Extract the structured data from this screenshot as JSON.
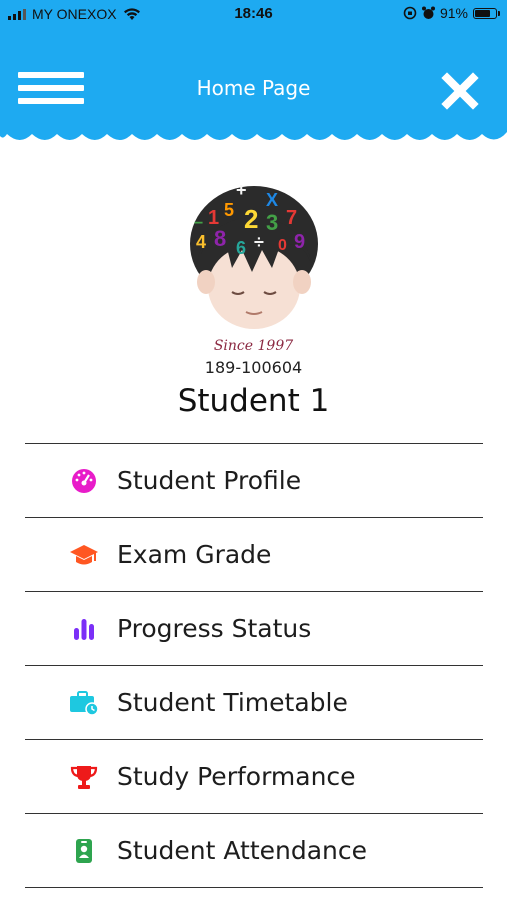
{
  "status": {
    "carrier": "MY ONEXOX",
    "time": "18:46",
    "battery": "91%",
    "battery_level": 0.91
  },
  "header": {
    "title": "Home Page",
    "menu_icon": "hamburger-menu-icon",
    "close_icon": "close-icon"
  },
  "profile": {
    "since": "Since 1997",
    "id": "189-100604",
    "name": "Student 1"
  },
  "menu": {
    "items": [
      {
        "label": "Student Profile",
        "icon": "dashboard-gauge-icon",
        "color": "#e81cc9"
      },
      {
        "label": "Exam Grade",
        "icon": "graduation-cap-icon",
        "color": "#ff5722"
      },
      {
        "label": "Progress Status",
        "icon": "bar-chart-icon",
        "color": "#7b2ff7"
      },
      {
        "label": "Student Timetable",
        "icon": "briefcase-clock-icon",
        "color": "#1ec8e0"
      },
      {
        "label": "Study Performance",
        "icon": "trophy-icon",
        "color": "#ee1a1a"
      },
      {
        "label": "Student Attendance",
        "icon": "id-badge-icon",
        "color": "#2ea44f"
      }
    ]
  },
  "colors": {
    "header_bg": "#1eaaf1",
    "text": "#1d1d1d"
  }
}
